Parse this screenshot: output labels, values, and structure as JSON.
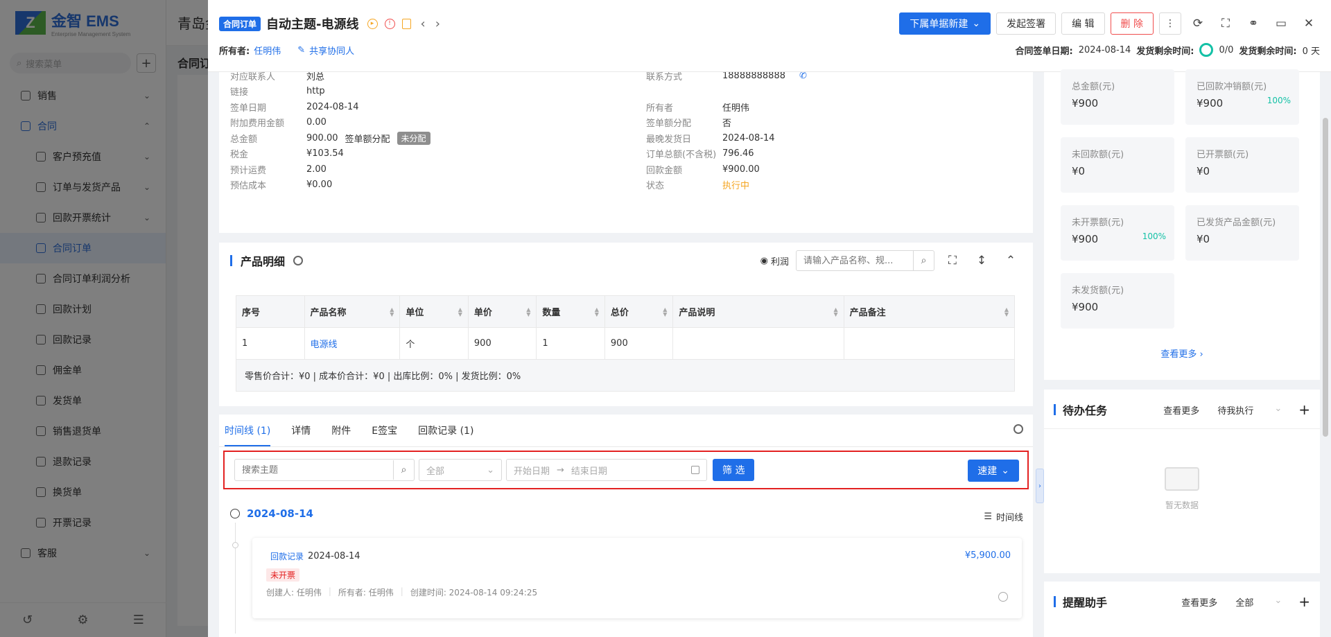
{
  "background": {
    "logo_mark": "Z",
    "logo_title": "金智 EMS",
    "logo_sub": "Enterprise Management System",
    "search_placeholder": "搜索菜单",
    "header_text": "青岛金",
    "main_title": "合同订",
    "menu": [
      {
        "label": "销售",
        "level": 0
      },
      {
        "label": "合同",
        "level": 0,
        "state": "open"
      },
      {
        "label": "客户预充值",
        "level": 1
      },
      {
        "label": "订单与发货产品",
        "level": 1
      },
      {
        "label": "回款开票统计",
        "level": 1
      },
      {
        "label": "合同订单",
        "level": 1,
        "state": "active"
      },
      {
        "label": "合同订单利润分析",
        "level": 1
      },
      {
        "label": "回款计划",
        "level": 1
      },
      {
        "label": "回款记录",
        "level": 1
      },
      {
        "label": "佣金单",
        "level": 1
      },
      {
        "label": "发货单",
        "level": 1
      },
      {
        "label": "销售退货单",
        "level": 1
      },
      {
        "label": "退款记录",
        "level": 1
      },
      {
        "label": "换货单",
        "level": 1
      },
      {
        "label": "开票记录",
        "level": 1
      },
      {
        "label": "客服",
        "level": 0
      }
    ]
  },
  "header": {
    "tag": "合同订单",
    "title": "自动主题-电源线",
    "actions": {
      "sub_new": "下属单据新建",
      "esign": "发起签署",
      "edit": "编 辑",
      "delete": "删 除"
    },
    "owner_label": "所有者:",
    "owner_value": "任明伟",
    "share_label": "共享协同人",
    "sign_date_label": "合同签单日期:",
    "sign_date_value": "2024-08-14",
    "ship_remaining_label": "发货剩余时间:",
    "ship_progress": "0/0",
    "ship_remaining_label2": "发货剩余时间:",
    "ship_days": "0 天"
  },
  "info": {
    "left": [
      {
        "label": "对应联系人",
        "value": "刘总",
        "link": true
      },
      {
        "label": "链接",
        "value": "http",
        "link": true
      },
      {
        "label": "签单日期",
        "value": "2024-08-14"
      },
      {
        "label": "附加费用金额",
        "value": "0.00"
      },
      {
        "label": "总金额",
        "value": "900.00",
        "extra_label": "签单额分配",
        "badge": "未分配"
      },
      {
        "label": "税金",
        "value": "¥103.54"
      },
      {
        "label": "预计运费",
        "value": "2.00"
      },
      {
        "label": "预估成本",
        "value": "¥0.00",
        "help": true
      }
    ],
    "right": [
      {
        "label": "联系方式",
        "value": "18888888888",
        "phone": true
      },
      {
        "label": "",
        "value": ""
      },
      {
        "label": "所有者",
        "value": "任明伟"
      },
      {
        "label": "签单额分配",
        "value": "否"
      },
      {
        "label": "最晚发货日",
        "value": "2024-08-14"
      },
      {
        "label": "订单总额(不含税)",
        "value": "796.46"
      },
      {
        "label": "回款金额",
        "value": "¥900.00",
        "help": true
      },
      {
        "label": "状态",
        "value": "执行中",
        "orange": true
      }
    ]
  },
  "products": {
    "title": "产品明细",
    "profit_label": "利润",
    "search_placeholder": "请输入产品名称、规...",
    "columns": [
      "序号",
      "产品名称",
      "单位",
      "单价",
      "数量",
      "总价",
      "产品说明",
      "产品备注"
    ],
    "rows": [
      [
        "1",
        "电源线",
        "个",
        "900",
        "1",
        "900",
        "",
        ""
      ]
    ],
    "summary": "零售价合计：¥0 |   成本价合计：¥0 |   出库比例：0% |   发货比例：0%"
  },
  "timeline": {
    "tabs": [
      "时间线 (1)",
      "详情",
      "附件",
      "E签宝",
      "回款记录 (1)"
    ],
    "search_placeholder": "搜索主题",
    "select_value": "全部",
    "start_date": "开始日期",
    "end_date": "结束日期",
    "filter_label": "筛 选",
    "quick_label": "速建",
    "date": "2024-08-14",
    "mode_label": "时间线",
    "item": {
      "tag": "回款记录",
      "date": "2024-08-14",
      "amount": "¥5,900.00",
      "status": "未开票",
      "creator": "创建人: 任明伟",
      "owner": "所有者: 任明伟",
      "created": "创建时间: 2024-08-14 09:24:25"
    }
  },
  "stats": {
    "items": [
      {
        "label": "总金额(元)",
        "value": "¥900",
        "pct": ""
      },
      {
        "label": "已回款冲销额(元)",
        "value": "¥900",
        "pct": "100%"
      },
      {
        "label": "未回款额(元)",
        "value": "¥0",
        "pct": ""
      },
      {
        "label": "已开票额(元)",
        "value": "¥0",
        "pct": ""
      },
      {
        "label": "未开票额(元)",
        "value": "¥900",
        "pct": "100%"
      },
      {
        "label": "已发货产品金额(元)",
        "value": "¥0",
        "pct": ""
      },
      {
        "label": "未发货额(元)",
        "value": "¥900",
        "pct": ""
      }
    ],
    "see_more": "查看更多"
  },
  "todo": {
    "title": "待办任务",
    "more": "查看更多",
    "select": "待我执行",
    "empty": "暂无数据"
  },
  "remind": {
    "title": "提醒助手",
    "more": "查看更多",
    "select": "全部"
  }
}
